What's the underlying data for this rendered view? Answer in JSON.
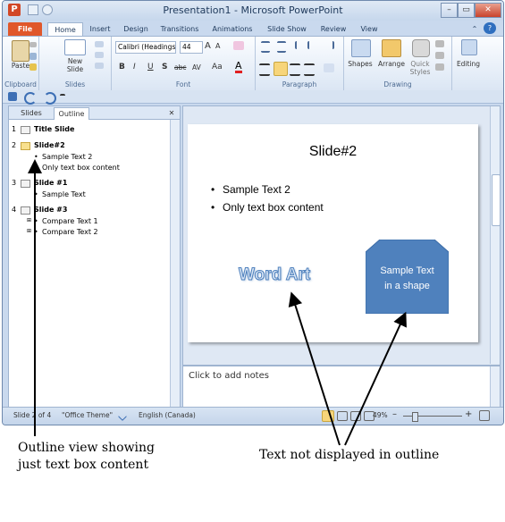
{
  "window": {
    "title": "Presentation1 - Microsoft PowerPoint",
    "app_icon": "P",
    "min_glyph": "–",
    "max_glyph": "▭",
    "close_glyph": "✕"
  },
  "ribbon_tabs": [
    "File",
    "Home",
    "Insert",
    "Design",
    "Transitions",
    "Animations",
    "Slide Show",
    "Review",
    "View"
  ],
  "ribbon": {
    "clipboard": {
      "paste": "Paste",
      "label": "Clipboard"
    },
    "slides": {
      "new_slide_1": "New",
      "new_slide_2": "Slide",
      "label": "Slides"
    },
    "font": {
      "font_name": "Calibri (Headings)",
      "font_size": "44",
      "bold": "B",
      "italic": "I",
      "underline": "U",
      "shadow": "S",
      "strike": "abc",
      "spacing": "AV",
      "case": "Aa",
      "color": "A",
      "grow": "A",
      "shrink": "A",
      "label": "Font"
    },
    "paragraph": {
      "label": "Paragraph"
    },
    "drawing": {
      "shapes": "Shapes",
      "arrange": "Arrange",
      "quick_styles_1": "Quick",
      "quick_styles_2": "Styles",
      "label": "Drawing"
    },
    "editing": {
      "label": "Editing"
    }
  },
  "outline_pane": {
    "tabs": [
      "Slides",
      "Outline"
    ],
    "close_glyph": "✕",
    "items": [
      {
        "num": "1",
        "title": "Title Slide",
        "bullets": []
      },
      {
        "num": "2",
        "title": "Slide#2",
        "bullets": [
          "Sample Text 2",
          "Only text box content"
        ]
      },
      {
        "num": "3",
        "title": "Slide  #1",
        "bullets": [
          "Sample Text"
        ]
      },
      {
        "num": "4",
        "title": "Slide  #3",
        "bullets": [
          "Compare Text 1",
          "Compare Text 2"
        ]
      }
    ],
    "bullet_glyph": "•"
  },
  "slide": {
    "title": "Slide#2",
    "bullets": [
      "Sample Text 2",
      "Only text box content"
    ],
    "word_art": "Word Art",
    "shape_text_1": "Sample Text",
    "shape_text_2": "in a shape",
    "shape_color": "#4f81bd"
  },
  "notes": {
    "placeholder": "Click to add notes"
  },
  "status_bar": {
    "slide_count": "Slide 2 of 4",
    "theme": "\"Office Theme\"",
    "language": "English (Canada)",
    "zoom": "49%",
    "minus": "–",
    "plus": "+"
  },
  "annotations": {
    "left_1": "Outline view showing",
    "left_2": "just text box content",
    "right": "Text not displayed in outline"
  }
}
